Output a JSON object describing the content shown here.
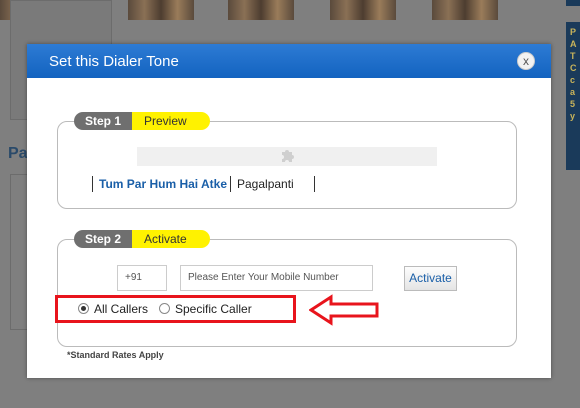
{
  "modal": {
    "title": "Set this Dialer Tone",
    "close_glyph": "x"
  },
  "step1": {
    "label": "Step 1",
    "name": "Preview",
    "song": "Tum Par Hum Hai Atke",
    "movie": "Pagalpanti"
  },
  "step2": {
    "label": "Step 2",
    "name": "Activate",
    "country_code": "+91",
    "mobile_placeholder": "Please Enter Your Mobile Number",
    "activate_label": "Activate",
    "options": {
      "all_callers": "All Callers",
      "specific_caller": "Specific Caller"
    },
    "selected": "all_callers"
  },
  "note": "*Standard Rates Apply",
  "background": {
    "heading": "Pa",
    "sidebar_text": "P A T C c a 5 y"
  },
  "colors": {
    "header": "#1a6ccc",
    "step_tag": "#fff200",
    "highlight": "#e8141c",
    "link": "#1a5fa8"
  },
  "icons": [
    "close-icon",
    "puzzle-icon",
    "arrow-left-icon"
  ]
}
